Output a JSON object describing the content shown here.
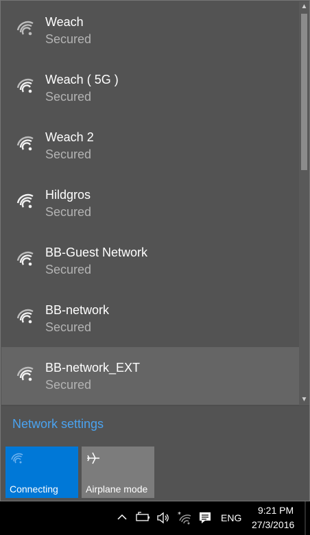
{
  "networks": [
    {
      "name": "Weach",
      "status": "Secured"
    },
    {
      "name": "Weach ( 5G )",
      "status": "Secured"
    },
    {
      "name": "Weach 2",
      "status": "Secured"
    },
    {
      "name": "Hildgros",
      "status": "Secured"
    },
    {
      "name": "BB-Guest Network",
      "status": "Secured"
    },
    {
      "name": "BB-network",
      "status": "Secured"
    },
    {
      "name": "BB-network_EXT",
      "status": "Secured"
    }
  ],
  "network_settings_label": "Network settings",
  "quick_actions": {
    "connecting": {
      "label": "Connecting",
      "icon": "wifi-icon",
      "color": "#0078d7"
    },
    "airplane": {
      "label": "Airplane mode",
      "icon": "airplane-icon",
      "color": "#7c7c7c"
    }
  },
  "taskbar": {
    "language": "ENG",
    "time": "9:21 PM",
    "date": "27/3/2016",
    "icons": [
      "chevron-up-icon",
      "battery-icon",
      "volume-icon",
      "wifi-icon",
      "action-center-icon"
    ]
  },
  "colors": {
    "accent": "#0078d7",
    "link": "#4aa3f0",
    "panel_bg": "#535353"
  }
}
